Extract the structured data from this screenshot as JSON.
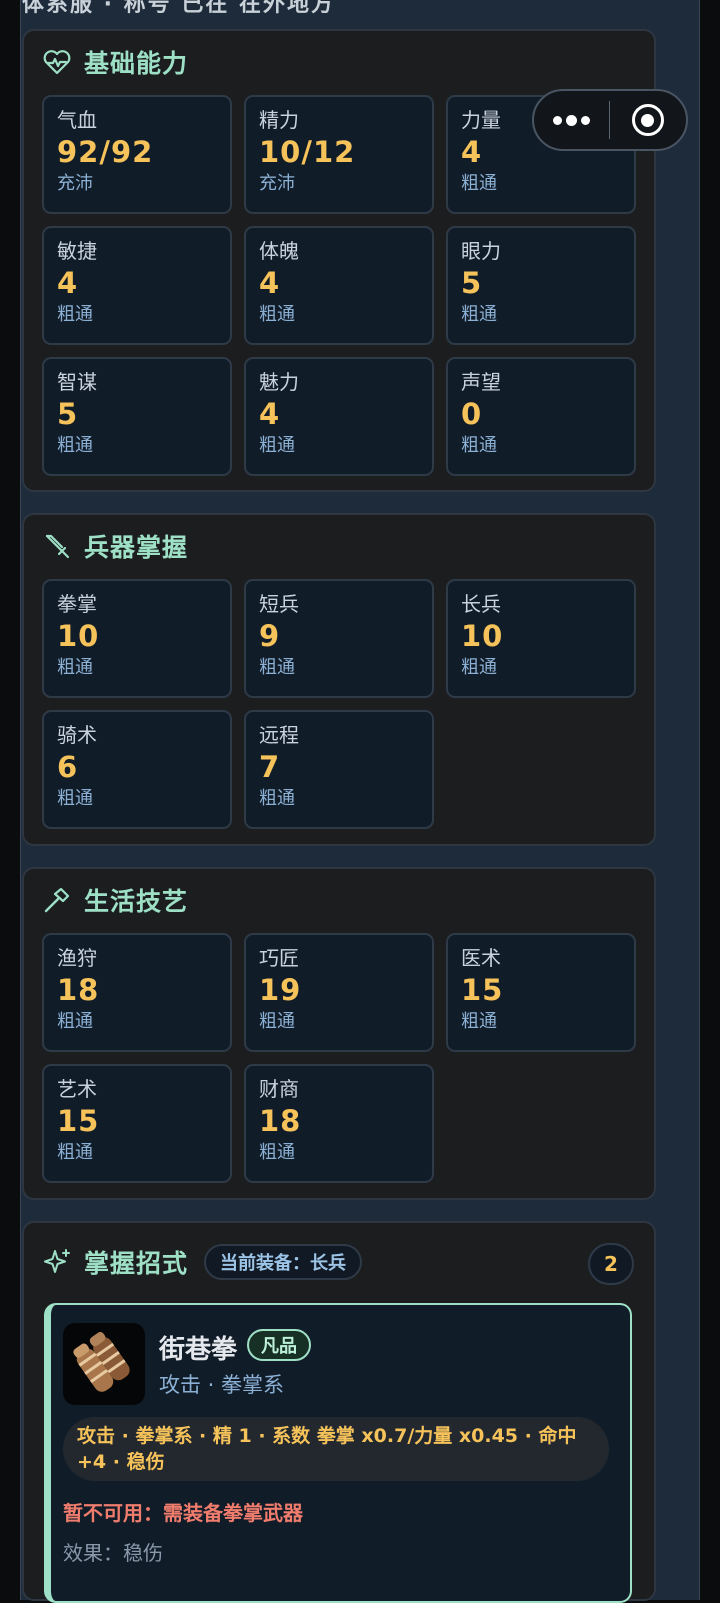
{
  "top_cut_text": "体系服 · 称号 已在 在外地方",
  "capsule": {
    "more_icon": "more-dots-icon",
    "close_icon": "target-close-icon"
  },
  "basic": {
    "title": "基础能力",
    "icon": "heartbeat-icon",
    "cards": [
      {
        "label": "气血",
        "value": "92/92",
        "sub": "充沛"
      },
      {
        "label": "精力",
        "value": "10/12",
        "sub": "充沛"
      },
      {
        "label": "力量",
        "value": "4",
        "sub": "粗通"
      },
      {
        "label": "敏捷",
        "value": "4",
        "sub": "粗通"
      },
      {
        "label": "体魄",
        "value": "4",
        "sub": "粗通"
      },
      {
        "label": "眼力",
        "value": "5",
        "sub": "粗通"
      },
      {
        "label": "智谋",
        "value": "5",
        "sub": "粗通"
      },
      {
        "label": "魅力",
        "value": "4",
        "sub": "粗通"
      },
      {
        "label": "声望",
        "value": "0",
        "sub": "粗通"
      }
    ]
  },
  "weapons": {
    "title": "兵器掌握",
    "icon": "sword-icon",
    "cards": [
      {
        "label": "拳掌",
        "value": "10",
        "sub": "粗通"
      },
      {
        "label": "短兵",
        "value": "9",
        "sub": "粗通"
      },
      {
        "label": "长兵",
        "value": "10",
        "sub": "粗通"
      },
      {
        "label": "骑术",
        "value": "6",
        "sub": "粗通"
      },
      {
        "label": "远程",
        "value": "7",
        "sub": "粗通"
      }
    ]
  },
  "life": {
    "title": "生活技艺",
    "icon": "hammer-icon",
    "cards": [
      {
        "label": "渔狩",
        "value": "18",
        "sub": "粗通"
      },
      {
        "label": "巧匠",
        "value": "19",
        "sub": "粗通"
      },
      {
        "label": "医术",
        "value": "15",
        "sub": "粗通"
      },
      {
        "label": "艺术",
        "value": "15",
        "sub": "粗通"
      },
      {
        "label": "财商",
        "value": "18",
        "sub": "粗通"
      }
    ]
  },
  "moves": {
    "title": "掌握招式",
    "icon": "sparkle-icon",
    "equipped": "当前装备：长兵",
    "count": "2",
    "item": {
      "icon": "fist-wrap-icon",
      "name": "街巷拳",
      "grade": "凡品",
      "type": "攻击 · 拳掌系",
      "stats": "攻击 · 拳掌系 · 精 1 · 系数 拳掌 x0.7/力量 x0.45 · 命中 +4 · 稳伤",
      "warning": "暂不可用：需装备拳掌武器",
      "effect": "效果：稳伤"
    }
  }
}
